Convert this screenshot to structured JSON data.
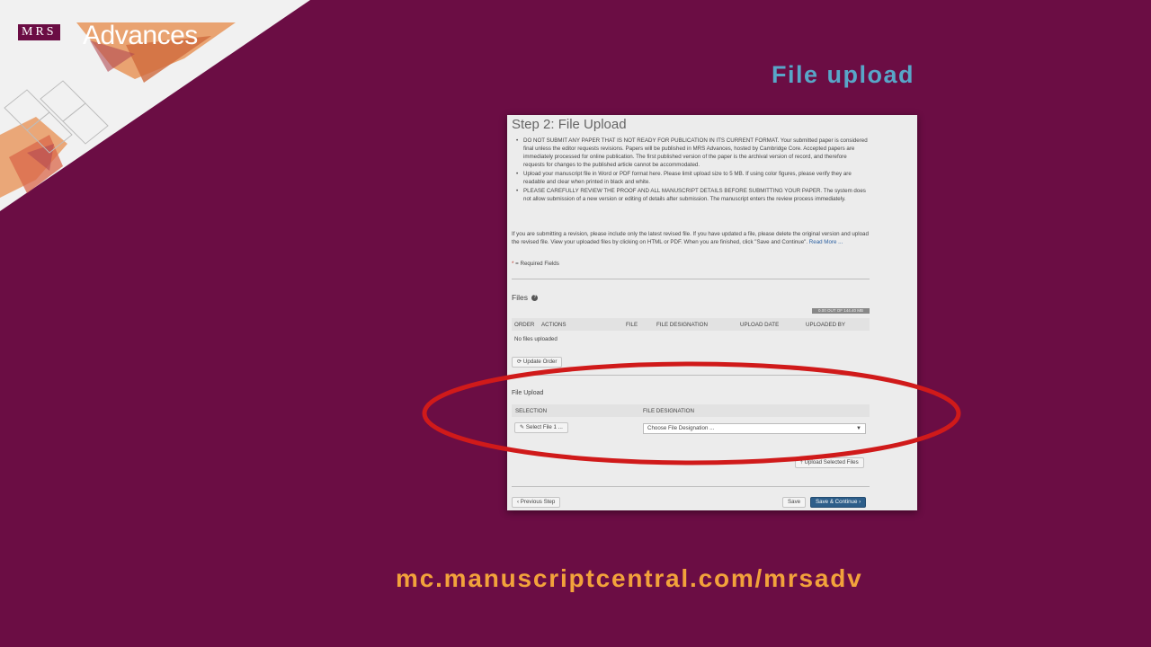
{
  "brand": {
    "mrs": "MRS",
    "journal": "Advances"
  },
  "slide": {
    "title": "File upload",
    "url": "mc.manuscriptcentral.com/mrsadv"
  },
  "form": {
    "step_title": "Step 2: File Upload",
    "instructions": [
      "DO NOT SUBMIT ANY PAPER THAT IS NOT READY FOR PUBLICATION IN ITS CURRENT FORMAT. Your submitted paper is considered final unless the editor requests revisions. Papers will be published in MRS Advances, hosted by Cambridge Core. Accepted papers are immediately processed for online publication. The first published version of the paper is the archival version of record, and therefore requests for changes to the published article cannot be accommodated.",
      "Upload your manuscript file in Word or PDF format here. Please limit upload size to 5 MB. If using color figures, please verify they are readable and clear when printed in black and white.",
      "PLEASE CAREFULLY REVIEW THE PROOF AND ALL MANUSCRIPT DETAILS BEFORE SUBMITTING YOUR PAPER. The system does not allow submission of a new version or editing of details after submission. The manuscript enters the review process immediately."
    ],
    "revision_note": "If you are submitting a revision, please include only the latest revised file. If you have updated a file, please delete the original version and upload the revised file. View your uploaded files by clicking on HTML or PDF. When you are finished, click \"Save and Continue\".",
    "read_more": "Read More ...",
    "required_note": "= Required Fields",
    "files_heading": "Files",
    "quota": "0.00 OUT OF 144.40 MB",
    "files_columns": [
      "ORDER",
      "ACTIONS",
      "FILE",
      "FILE DESIGNATION",
      "UPLOAD DATE",
      "UPLOADED BY"
    ],
    "no_files": "No files uploaded",
    "update_order": "Update Order",
    "file_upload_heading": "File Upload",
    "upload_columns": [
      "SELECTION",
      "FILE DESIGNATION"
    ],
    "select_file": "Select File 1 ...",
    "designation_placeholder": "Choose File Designation ...",
    "upload_selected": "Upload Selected Files",
    "previous_step": "Previous Step",
    "save": "Save",
    "save_continue": "Save & Continue"
  },
  "colors": {
    "background": "#6b0d44",
    "title": "#58a6c8",
    "url": "#f2a23b",
    "highlight_ellipse": "#d01a1a",
    "primary_button": "#2d5e8a"
  }
}
